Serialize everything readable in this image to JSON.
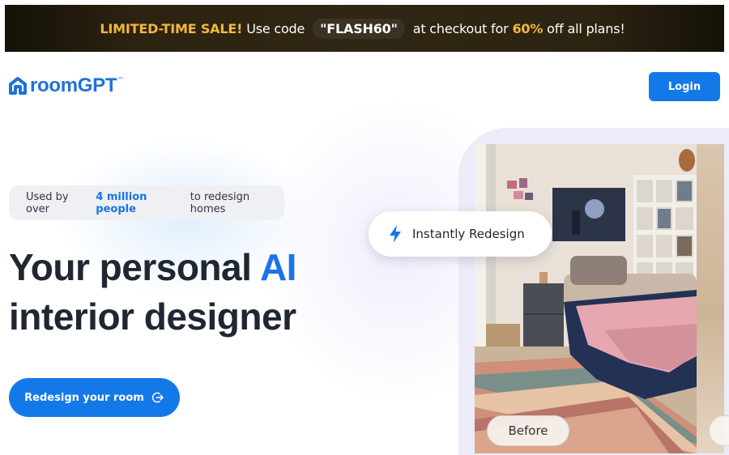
{
  "promo": {
    "sale_label": "LIMITED-TIME SALE!",
    "use_code_text": "Use code",
    "code": "\"FLASH60\"",
    "checkout_text": "at checkout for",
    "discount": "60%",
    "tail_text": "off all plans!"
  },
  "header": {
    "logo_text": "roomGPT",
    "logo_tm": "™",
    "login_label": "Login"
  },
  "hero": {
    "pill_prefix": "Used by over",
    "pill_highlight": "4 million people",
    "pill_suffix": "to redesign homes",
    "headline_part1": "Your personal ",
    "headline_ai": "AI",
    "headline_line2": "interior designer",
    "cta_label": "Redesign your room"
  },
  "showcase": {
    "badge_label": "Instantly Redesign",
    "before_label": "Before"
  },
  "colors": {
    "brand_blue": "#1479e8",
    "promo_gold": "#f4b73a",
    "headline_dark": "#202733"
  }
}
